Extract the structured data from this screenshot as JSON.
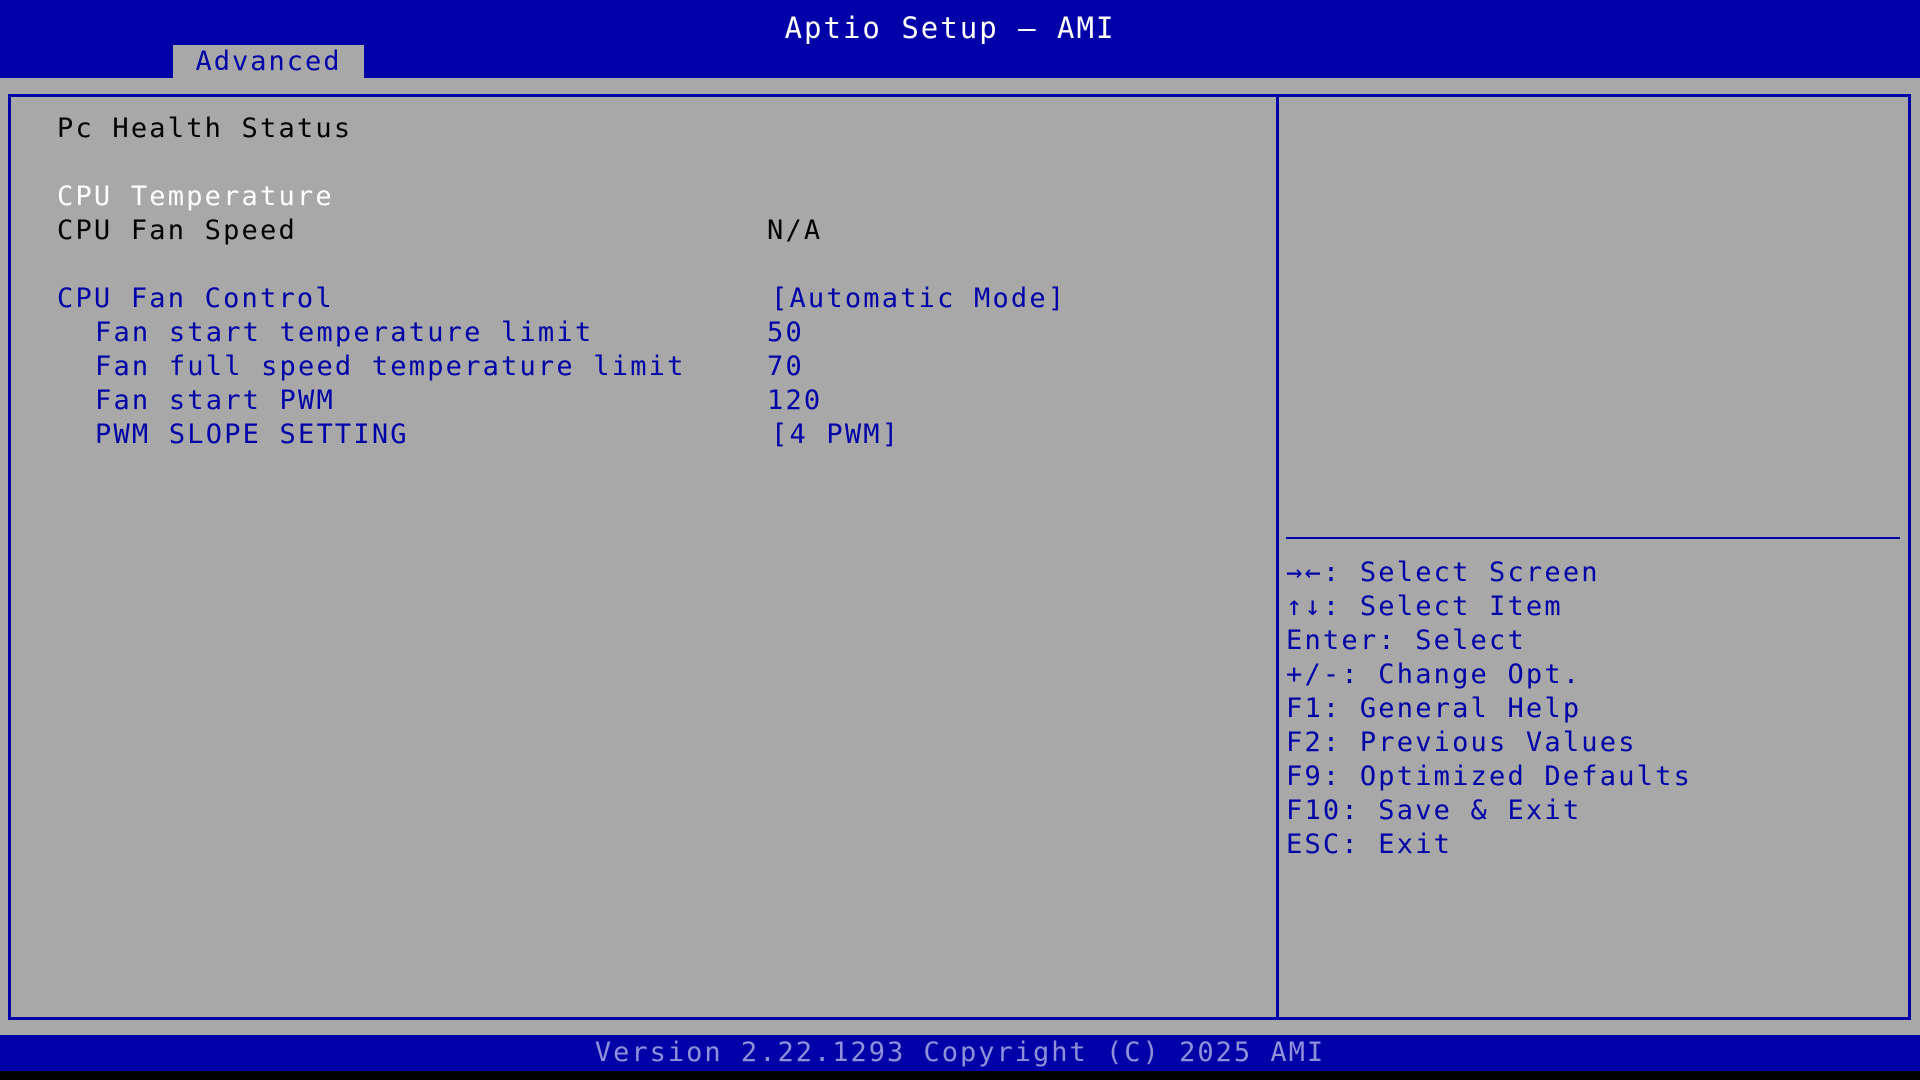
{
  "header": {
    "title": "Aptio Setup – AMI",
    "tabs": [
      {
        "label": "Advanced"
      }
    ]
  },
  "main": {
    "section_title": "Pc Health Status",
    "items": [
      {
        "label": "CPU Temperature",
        "value": ""
      },
      {
        "label": "CPU Fan Speed",
        "value": "N/A"
      },
      {
        "label": "CPU Fan Control",
        "value": "[Automatic Mode]"
      },
      {
        "label": "Fan start temperature limit",
        "value": "50"
      },
      {
        "label": "Fan full speed temperature limit",
        "value": "70"
      },
      {
        "label": "Fan start PWM",
        "value": "120"
      },
      {
        "label": "PWM SLOPE SETTING",
        "value": "[4 PWM]"
      }
    ]
  },
  "help": {
    "keys": [
      "→←: Select Screen",
      "↑↓: Select Item",
      "Enter: Select",
      "+/-: Change Opt.",
      "F1: General Help",
      "F2: Previous Values",
      "F9: Optimized Defaults",
      "F10: Save & Exit",
      "ESC: Exit"
    ]
  },
  "footer": {
    "text": "Version 2.22.1293 Copyright (C) 2025 AMI"
  },
  "colors": {
    "bios_blue": "#0000a8",
    "panel_gray": "#a8a8a8",
    "highlight_white": "#ffffff",
    "static_black": "#000000"
  }
}
